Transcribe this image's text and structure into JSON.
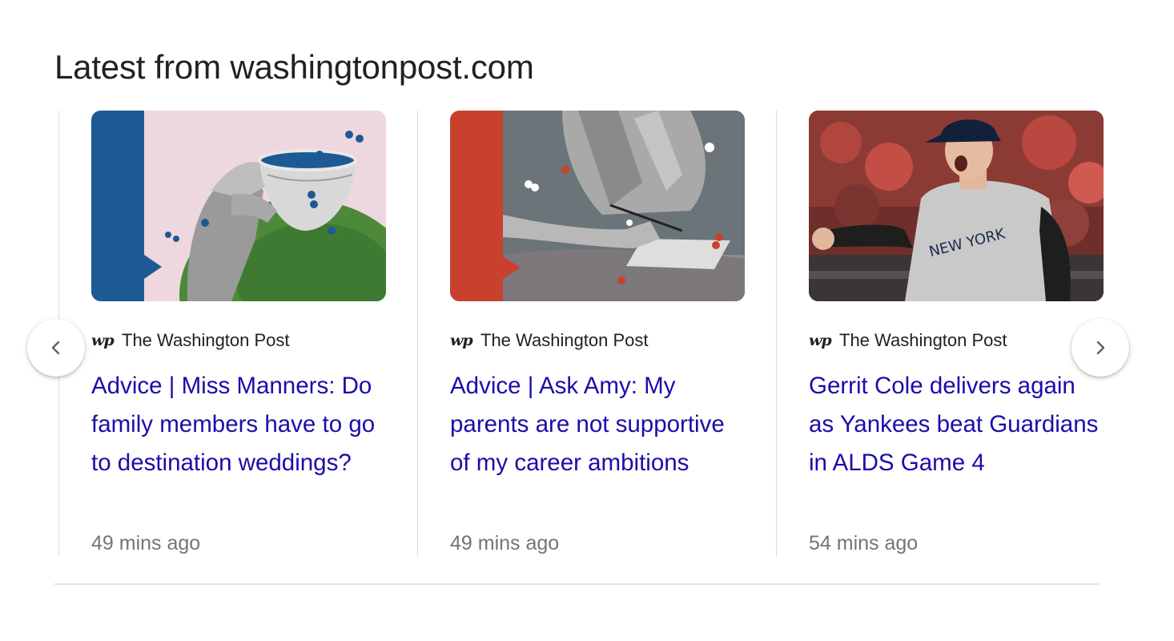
{
  "section": {
    "title": "Latest from washingtonpost.com"
  },
  "cards": [
    {
      "image": "tea-cup-illustration",
      "source_logo": "wp",
      "source_name": "The Washington Post",
      "headline": "Advice | Miss Manners: Do family members have to go to destination weddings?",
      "time": "49 mins ago"
    },
    {
      "image": "writing-hand-illustration",
      "source_logo": "wp",
      "source_name": "The Washington Post",
      "headline": "Advice | Ask Amy: My parents are not supportive of my career ambitions",
      "time": "49 mins ago"
    },
    {
      "image": "yankees-pitcher-photo",
      "source_logo": "wp",
      "source_name": "The Washington Post",
      "headline": "Gerrit Cole delivers again as Yankees beat Guardians in ALDS Game 4",
      "time": "54 mins ago"
    }
  ],
  "carousel": {
    "prev_icon": "chevron-left-icon",
    "next_icon": "chevron-right-icon"
  },
  "colors": {
    "link": "#1a0dab",
    "meta": "#70757a",
    "text": "#202124",
    "divider": "#dadce0"
  }
}
